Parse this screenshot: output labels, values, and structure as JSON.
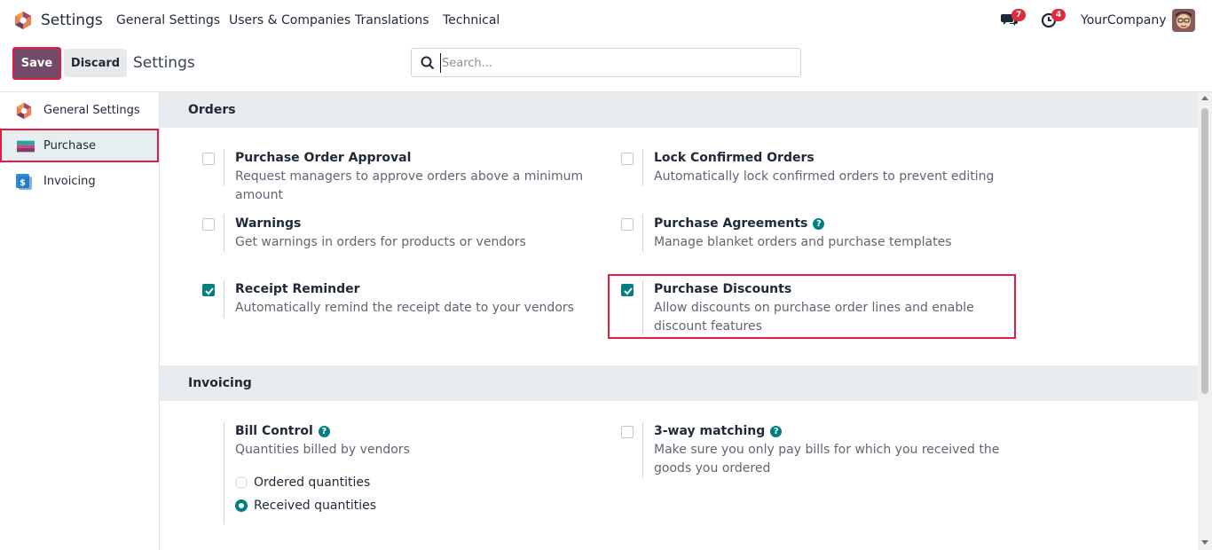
{
  "navbar": {
    "app_name": "Settings",
    "menus": [
      "General Settings",
      "Users & Companies",
      "Translations",
      "Technical"
    ],
    "messages_count": "7",
    "activities_count": "4",
    "company": "YourCompany",
    "icons": {
      "logo": "odoo-hexagon-logo",
      "messages": "chat-bubbles-icon",
      "activities": "clock-icon",
      "avatar": "user-avatar"
    }
  },
  "control_panel": {
    "save_label": "Save",
    "discard_label": "Discard",
    "title": "Settings",
    "search_placeholder": "Search..."
  },
  "sidebar": {
    "items": [
      {
        "label": "General Settings",
        "icon": "general-settings-icon",
        "active": false
      },
      {
        "label": "Purchase",
        "icon": "purchase-icon",
        "active": true
      },
      {
        "label": "Invoicing",
        "icon": "invoicing-icon",
        "active": false
      }
    ]
  },
  "sections": {
    "orders": {
      "title": "Orders",
      "settings": [
        {
          "title": "Purchase Order Approval",
          "desc": "Request managers to approve orders above a minimum amount",
          "checked": false
        },
        {
          "title": "Lock Confirmed Orders",
          "desc": "Automatically lock confirmed orders to prevent editing",
          "checked": false
        },
        {
          "title": "Warnings",
          "desc": "Get warnings in orders for products or vendors",
          "checked": false
        },
        {
          "title": "Purchase Agreements",
          "desc": "Manage blanket orders and purchase templates",
          "checked": false,
          "help": true
        },
        {
          "title": "Receipt Reminder",
          "desc": "Automatically remind the receipt date to your vendors",
          "checked": true
        },
        {
          "title": "Purchase Discounts",
          "desc": "Allow discounts on purchase order lines and enable discount features",
          "checked": true
        }
      ]
    },
    "invoicing": {
      "title": "Invoicing",
      "bill_control": {
        "title": "Bill Control",
        "desc": "Quantities billed by vendors",
        "options": [
          "Ordered quantities",
          "Received quantities"
        ],
        "selected": "Received quantities"
      },
      "three_way": {
        "title": "3-way matching",
        "desc": "Make sure you only pay bills for which you received the goods you ordered",
        "checked": false
      }
    }
  },
  "colors": {
    "brand": "#714b67",
    "accent": "#017e84",
    "highlight": "#e11d48",
    "badge": "#e02b3b"
  }
}
